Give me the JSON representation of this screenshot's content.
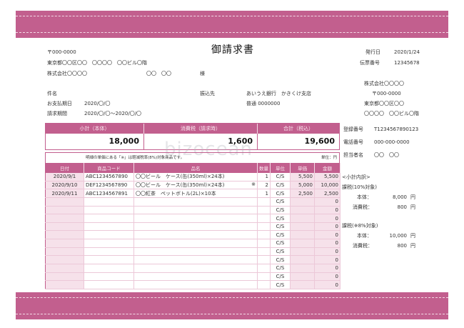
{
  "title": "御請求書",
  "watermark": "bizocean",
  "client": {
    "postal": "〒000-0000",
    "address": "東京都〇〇区〇〇　〇〇〇〇　〇〇ビル〇階",
    "company": "株式会社〇〇〇〇",
    "person": "〇〇　〇〇",
    "honorific": "様"
  },
  "meta": {
    "issue_label": "発行日",
    "issue_value": "2020/1/24",
    "slip_label": "伝票番号",
    "slip_value": "12345678"
  },
  "subject_label": "件名",
  "due_label": "お支払期日",
  "due_value": "2020/〇/〇",
  "period_label": "請求期間",
  "period_value": "2020/〇/〇〜2020/〇/〇",
  "bank": {
    "label": "振込先",
    "bank_name": "あいうえ銀行　かきくけ支店",
    "account": "普通 0000000"
  },
  "issuer": {
    "company": "株式会社〇〇〇〇",
    "postal": "〒000-0000",
    "address1": "東京都〇〇区〇〇",
    "address2": "〇〇〇〇　〇〇ビル〇階",
    "reg_label": "登録番号",
    "reg_value": "T1234567890123",
    "tel_label": "電話番号",
    "tel_value": "000-000-0000",
    "staff_label": "担当者名",
    "staff_value": "〇〇　〇〇"
  },
  "summary": {
    "subtotal_label": "小計（本体）",
    "subtotal_value": "18,000",
    "tax_label": "消費税（請求時）",
    "tax_value": "1,600",
    "total_label": "合計（税込）",
    "total_value": "19,600"
  },
  "note": "明細の単価にある「※」は軽減税率(8%)対象商品です。",
  "unit_note": "単位：円",
  "table": {
    "headers": [
      "日付",
      "商品コード",
      "品名",
      "数量",
      "単位",
      "単価",
      "金額"
    ],
    "rows": [
      {
        "date": "2020/9/1",
        "code": "ABC1234567890",
        "name": "〇〇ビール　ケース(缶(350ml)×24本)",
        "mark": "",
        "qty": "1",
        "unit": "C/S",
        "price": "5,500",
        "amount": "5,500"
      },
      {
        "date": "2020/9/10",
        "code": "DEF1234567890",
        "name": "〇〇ビール　ケース(缶(350ml)×24本)",
        "mark": "※",
        "qty": "2",
        "unit": "C/S",
        "price": "5,000",
        "amount": "10,000"
      },
      {
        "date": "2020/9/11",
        "code": "ABC1234567891",
        "name": "〇〇紅茶　ペットボトル(2L)×10本",
        "mark": "",
        "qty": "1",
        "unit": "C/S",
        "price": "2,500",
        "amount": "2,500"
      },
      {
        "date": "",
        "code": "",
        "name": "",
        "mark": "",
        "qty": "",
        "unit": "C/S",
        "price": "",
        "amount": "0"
      },
      {
        "date": "",
        "code": "",
        "name": "",
        "mark": "",
        "qty": "",
        "unit": "C/S",
        "price": "",
        "amount": "0"
      },
      {
        "date": "",
        "code": "",
        "name": "",
        "mark": "",
        "qty": "",
        "unit": "C/S",
        "price": "",
        "amount": "0"
      },
      {
        "date": "",
        "code": "",
        "name": "",
        "mark": "",
        "qty": "",
        "unit": "C/S",
        "price": "",
        "amount": "0"
      },
      {
        "date": "",
        "code": "",
        "name": "",
        "mark": "",
        "qty": "",
        "unit": "C/S",
        "price": "",
        "amount": "0"
      },
      {
        "date": "",
        "code": "",
        "name": "",
        "mark": "",
        "qty": "",
        "unit": "C/S",
        "price": "",
        "amount": "0"
      },
      {
        "date": "",
        "code": "",
        "name": "",
        "mark": "",
        "qty": "",
        "unit": "C/S",
        "price": "",
        "amount": "0"
      },
      {
        "date": "",
        "code": "",
        "name": "",
        "mark": "",
        "qty": "",
        "unit": "C/S",
        "price": "",
        "amount": "0"
      },
      {
        "date": "",
        "code": "",
        "name": "",
        "mark": "",
        "qty": "",
        "unit": "C/S",
        "price": "",
        "amount": "0"
      },
      {
        "date": "",
        "code": "",
        "name": "",
        "mark": "",
        "qty": "",
        "unit": "C/S",
        "price": "",
        "amount": "0"
      },
      {
        "date": "",
        "code": "",
        "name": "",
        "mark": "",
        "qty": "",
        "unit": "C/S",
        "price": "",
        "amount": "0"
      }
    ]
  },
  "breakdown": {
    "title": "<小計内訳>",
    "std_label": "課税(10%対象)",
    "std_body_label": "本体：",
    "std_body_value": "8,000",
    "std_body_unit": "円",
    "std_tax_label": "消費税：",
    "std_tax_value": "800",
    "std_tax_unit": "円",
    "red_label": "課税(※8%対象)",
    "red_body_label": "本体：",
    "red_body_value": "10,000",
    "red_body_unit": "円",
    "red_tax_label": "消費税：",
    "red_tax_value": "800",
    "red_tax_unit": "円"
  },
  "colors": {
    "accent": "#c25f8e",
    "accent_light": "#f6e1ea"
  }
}
